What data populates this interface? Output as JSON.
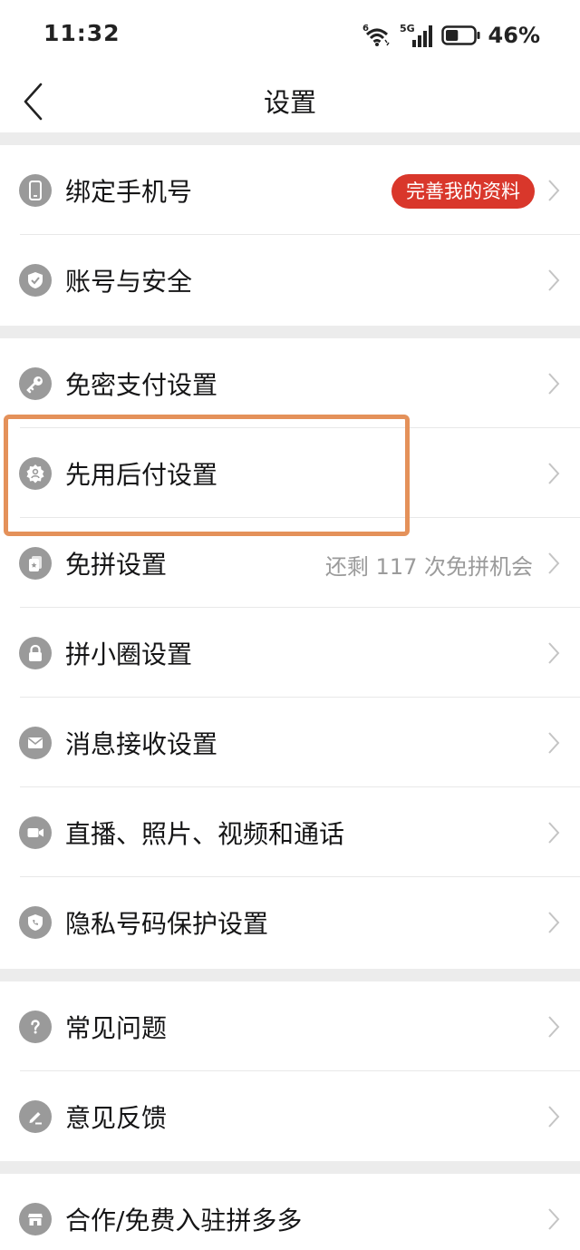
{
  "status_bar": {
    "time": "11:32",
    "battery_percent": "46%",
    "network": "5G",
    "wifi_label": "6",
    "battery_level": 0.46
  },
  "nav": {
    "title": "设置"
  },
  "rows": [
    {
      "label": "绑定手机号",
      "badge": "完善我的资料",
      "icon": "phone-icon"
    },
    {
      "label": "账号与安全",
      "icon": "shield-check-icon"
    },
    {
      "label": "免密支付设置",
      "icon": "key-icon"
    },
    {
      "label": "先用后付设置",
      "icon": "pay-later-icon"
    },
    {
      "label": "免拼设置",
      "right_text": "还剩 117 次免拼机会",
      "icon": "coupon-icon"
    },
    {
      "label": "拼小圈设置",
      "icon": "lock-icon"
    },
    {
      "label": "消息接收设置",
      "icon": "mail-icon"
    },
    {
      "label": "直播、照片、视频和通话",
      "icon": "video-camera-icon"
    },
    {
      "label": "隐私号码保护设置",
      "icon": "privacy-phone-icon"
    },
    {
      "label": "常见问题",
      "icon": "question-icon"
    },
    {
      "label": "意见反馈",
      "icon": "pencil-icon"
    },
    {
      "label": "合作/免费入驻拼多多",
      "icon": "store-icon"
    }
  ],
  "colors": {
    "badge": "#d9372b",
    "highlight": "#e4915a",
    "icon_bg": "#9a9a9a",
    "section_gap": "#ececec"
  }
}
